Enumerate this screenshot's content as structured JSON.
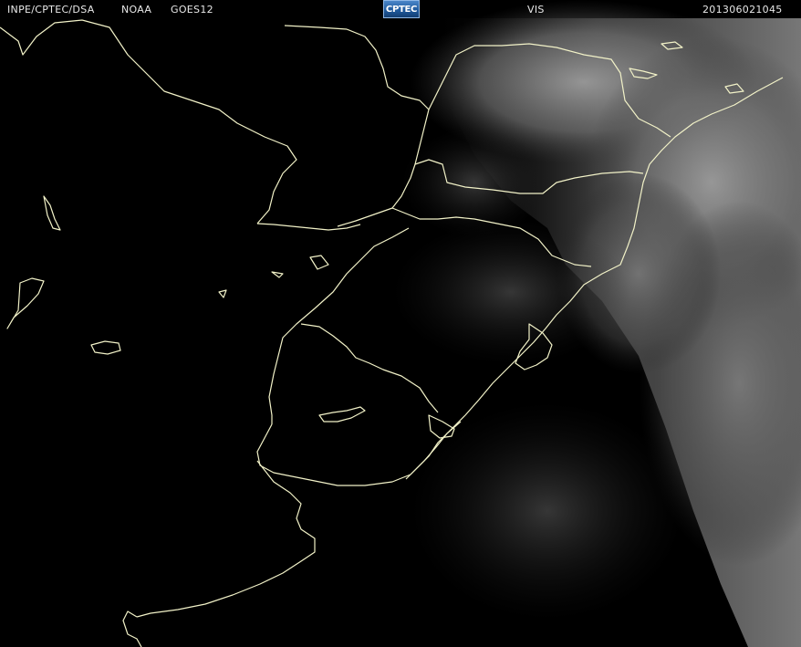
{
  "header": {
    "agency": "INPE/CPTEC/DSA",
    "operator": "NOAA",
    "satellite": "GOES12",
    "logo_text": "CPTEC",
    "channel": "VIS",
    "timestamp": "201306021045"
  },
  "imagery": {
    "background_color": "#000000",
    "coastline_color": "#f2f2c8",
    "cloud_color": "#8a8a8a"
  }
}
